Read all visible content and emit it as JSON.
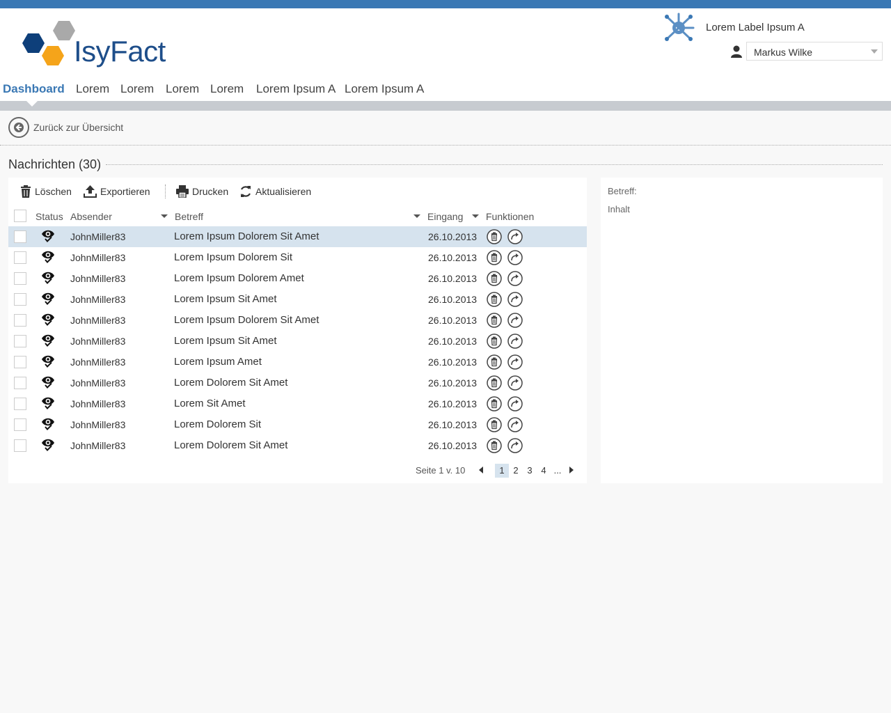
{
  "app": {
    "logo_text": "IsyFact",
    "label": "Lorem Label Ipsum A",
    "user": "Markus Wilke"
  },
  "nav": {
    "items": [
      "Dashboard",
      "Lorem",
      "Lorem",
      "Lorem",
      "Lorem",
      "Lorem Ipsum A",
      "Lorem Ipsum A"
    ],
    "active_index": 0
  },
  "back_link": "Zurück zur Übersicht",
  "section": {
    "title": "Nachrichten (30)"
  },
  "toolbar": {
    "delete": "Löschen",
    "export": "Exportieren",
    "print": "Drucken",
    "refresh": "Aktualisieren"
  },
  "table": {
    "headers": {
      "status": "Status",
      "sender": "Absender",
      "subject": "Betreff",
      "date": "Eingang",
      "functions": "Funktionen"
    },
    "rows": [
      {
        "sender": "JohnMiller83",
        "subject": "Lorem Ipsum Dolorem Sit Amet",
        "date": "26.10.2013",
        "selected": true
      },
      {
        "sender": "JohnMiller83",
        "subject": "Lorem Ipsum Dolorem Sit",
        "date": "26.10.2013"
      },
      {
        "sender": "JohnMiller83",
        "subject": "Lorem Ipsum Dolorem Amet",
        "date": "26.10.2013"
      },
      {
        "sender": "JohnMiller83",
        "subject": "Lorem Ipsum Sit Amet",
        "date": "26.10.2013"
      },
      {
        "sender": "JohnMiller83",
        "subject": "Lorem Ipsum Dolorem Sit Amet",
        "date": "26.10.2013"
      },
      {
        "sender": "JohnMiller83",
        "subject": "Lorem Ipsum Sit Amet",
        "date": "26.10.2013"
      },
      {
        "sender": "JohnMiller83",
        "subject": "Lorem Ipsum Amet",
        "date": "26.10.2013"
      },
      {
        "sender": "JohnMiller83",
        "subject": "Lorem Dolorem Sit Amet",
        "date": "26.10.2013"
      },
      {
        "sender": "JohnMiller83",
        "subject": "Lorem Sit Amet",
        "date": "26.10.2013"
      },
      {
        "sender": "JohnMiller83",
        "subject": "Lorem Dolorem Sit",
        "date": "26.10.2013"
      },
      {
        "sender": "JohnMiller83",
        "subject": "Lorem Dolorem Sit Amet",
        "date": "26.10.2013"
      }
    ]
  },
  "pager": {
    "info": "Seite 1 v. 10",
    "pages": [
      "1",
      "2",
      "3",
      "4"
    ],
    "ellipsis": "...",
    "current": "1"
  },
  "detail": {
    "subject_label": "Betreff:",
    "content_label": "Inhalt"
  },
  "colors": {
    "accent": "#3a78b4",
    "selected_row": "#d6e3ee",
    "nav_strip": "#c7cbd0"
  }
}
